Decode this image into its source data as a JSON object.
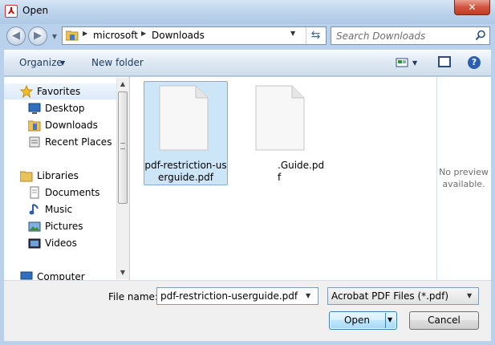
{
  "window": {
    "title": "Open",
    "close_glyph": "✕"
  },
  "address": {
    "crumbs": [
      "microsoft",
      "Downloads"
    ],
    "search_placeholder": "Search Downloads"
  },
  "toolbar": {
    "organize_label": "Organize",
    "new_folder_label": "New folder",
    "help_glyph": "?"
  },
  "nav": {
    "favorites": {
      "label": "Favorites",
      "items": [
        "Desktop",
        "Downloads",
        "Recent Places"
      ]
    },
    "libraries": {
      "label": "Libraries",
      "items": [
        "Documents",
        "Music",
        "Pictures",
        "Videos"
      ]
    },
    "computer": {
      "label": "Computer"
    }
  },
  "files": [
    {
      "name_line1": "pdf-restriction-us",
      "name_line2": "erguide.pdf",
      "selected": true
    },
    {
      "name_line1": ".Guide.pd",
      "name_line2": "f",
      "selected": false
    }
  ],
  "preview": {
    "line1": "No preview",
    "line2": "available."
  },
  "bottom": {
    "filename_label": "File name:",
    "filename_value": "pdf-restriction-userguide.pdf",
    "filetype_value": "Acrobat PDF Files (*.pdf)",
    "open_label": "Open",
    "cancel_label": "Cancel"
  },
  "colors": {
    "selection": "#cde6f7",
    "selection_border": "#84acdd",
    "frame": "#b9d1ea",
    "close": "#c43a22"
  },
  "icons": {
    "app": "acrobat-icon",
    "back": "back-arrow-icon",
    "forward": "forward-arrow-icon",
    "refresh": "refresh-icon",
    "search": "search-icon",
    "view": "view-icon",
    "preview": "preview-pane-icon",
    "help": "help-icon"
  }
}
